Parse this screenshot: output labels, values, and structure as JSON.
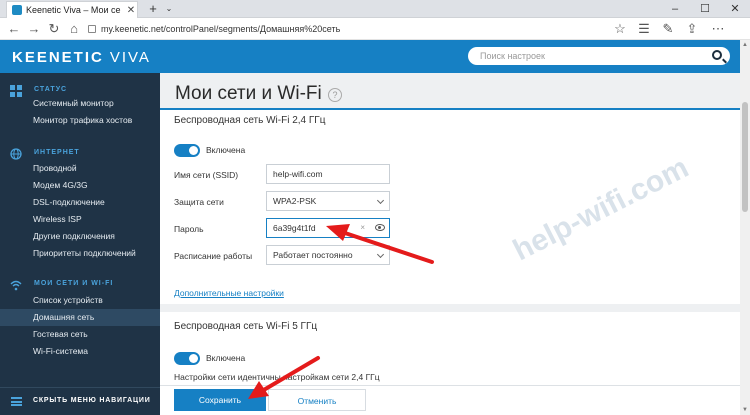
{
  "browser": {
    "tab_title": "Keenetic Viva – Мои се",
    "url": "my.keenetic.net/controlPanel/segments/Домашняя%20сеть"
  },
  "header": {
    "brand": "KEENETIC",
    "brand_model": "VIVA",
    "search_placeholder": "Поиск настроек"
  },
  "sidebar": {
    "sections": [
      {
        "label": "СТАТУС",
        "items": [
          "Системный монитор",
          "Монитор трафика хостов"
        ]
      },
      {
        "label": "ИНТЕРНЕТ",
        "items": [
          "Проводной",
          "Модем 4G/3G",
          "DSL-подключение",
          "Wireless ISP",
          "Другие подключения",
          "Приоритеты подключений"
        ]
      },
      {
        "label": "МОИ СЕТИ И WI-FI",
        "items": [
          "Список устройств",
          "Домашняя сеть",
          "Гостевая сеть",
          "Wi-Fi-система"
        ]
      }
    ],
    "active_item": "Домашняя сеть",
    "footer_label": "СКРЫТЬ МЕНЮ НАВИГАЦИИ"
  },
  "main": {
    "page_title": "Мои сети и Wi-Fi",
    "wifi24": {
      "title": "Беспроводная сеть Wi-Fi 2,4 ГГц",
      "toggle_label": "Включена",
      "ssid_label": "Имя сети (SSID)",
      "ssid_value": "help-wifi.com",
      "security_label": "Защита сети",
      "security_value": "WPA2-PSK",
      "password_label": "Пароль",
      "password_value": "6a39g4t1fd",
      "schedule_label": "Расписание работы",
      "schedule_value": "Работает постоянно",
      "advanced_link": "Дополнительные настройки"
    },
    "wifi5": {
      "title": "Беспроводная сеть Wi-Fi 5 ГГц",
      "toggle_label": "Включена",
      "note": "Настройки сети идентичны настройкам сети 2,4 ГГц"
    },
    "buttons": {
      "save": "Сохранить",
      "cancel": "Отменить"
    }
  },
  "watermark": "help-wifi.com",
  "colors": {
    "accent": "#1680c4",
    "sidebar_bg": "#1f3346",
    "arrow": "#e41b1b"
  }
}
